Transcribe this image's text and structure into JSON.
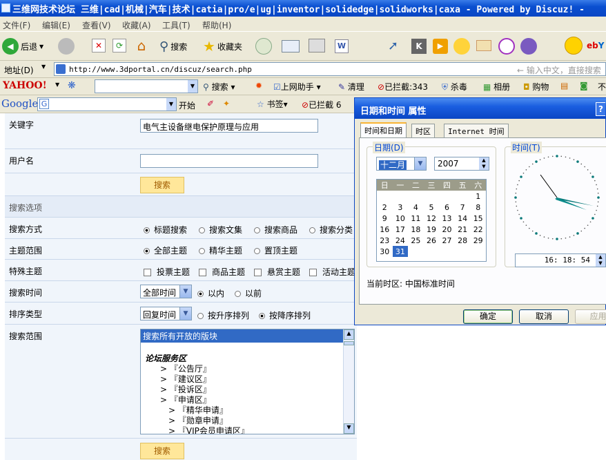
{
  "window": {
    "title": "三维网技术论坛 三维|cad|机械|汽车|技术|catia|pro/e|ug|inventor|solidedge|solidworks|caxa - Powered by Discuz! -"
  },
  "menu": [
    "文件(F)",
    "编辑(E)",
    "查看(V)",
    "收藏(A)",
    "工具(T)",
    "帮助(H)"
  ],
  "toolbar": {
    "back": "后退",
    "search": "搜索",
    "favorites": "收藏夹"
  },
  "address": {
    "label": "地址(D)",
    "url": "http://www.3dportal.cn/discuz/search.php",
    "hint": "输入中文，直接搜索"
  },
  "yahoo": {
    "logo": "YAHOO!",
    "search": "搜索",
    "helper": "上网助手",
    "clean": "清理",
    "blocked": "已拦截:343",
    "kill": "杀毒",
    "album": "相册",
    "shop": "购物",
    "more": "不"
  },
  "google": {
    "logo": "Google",
    "go": "开始",
    "bookmarks": "书签",
    "blocked": "已拦截 6"
  },
  "form": {
    "keyword_label": "关键字",
    "keyword_value": "电气主设备继电保护原理与应用",
    "username_label": "用户名",
    "username_value": "",
    "search_btn": "搜索",
    "options_header": "搜索选项",
    "method_label": "搜索方式",
    "method_options": [
      "标题搜索",
      "搜索文集",
      "搜索商品",
      "搜索分类"
    ],
    "scope_label": "主题范围",
    "scope_options": [
      "全部主题",
      "精华主题",
      "置顶主题"
    ],
    "special_label": "特殊主题",
    "special_options": [
      "投票主题",
      "商品主题",
      "悬赏主题",
      "活动主题"
    ],
    "time_label": "搜索时间",
    "time_value": "全部时间",
    "time_options": [
      "以内",
      "以前"
    ],
    "sort_label": "排序类型",
    "sort_value": "回复时间",
    "sort_options": [
      "按升序排列",
      "按降序排列"
    ],
    "forums_label": "搜索范围",
    "forums_selected": "搜索所有开放的版块",
    "forums_group": "论坛服务区",
    "forums_items": [
      "> 『公告厅』",
      "> 『建议区』",
      "> 『投诉区』",
      "> 『申请区』",
      "> 『精华申请』",
      "> 『勋章申请』",
      "> 『VIP会员申请区』"
    ],
    "search_btn2": "搜索"
  },
  "dialog": {
    "title": "日期和时间 属性",
    "help": "?",
    "tabs": [
      "时间和日期",
      "时区",
      "Internet 时间"
    ],
    "date_label": "日期(D)",
    "month": "十二月",
    "year": "2007",
    "weekdays": [
      "日",
      "一",
      "二",
      "三",
      "四",
      "五",
      "六"
    ],
    "days": [
      [
        "",
        "",
        "",
        "",
        "",
        "",
        "1"
      ],
      [
        "2",
        "3",
        "4",
        "5",
        "6",
        "7",
        "8"
      ],
      [
        "9",
        "10",
        "11",
        "12",
        "13",
        "14",
        "15"
      ],
      [
        "16",
        "17",
        "18",
        "19",
        "20",
        "21",
        "22"
      ],
      [
        "23",
        "24",
        "25",
        "26",
        "27",
        "28",
        "29"
      ],
      [
        "30",
        "31",
        "",
        "",
        "",
        "",
        ""
      ]
    ],
    "selected_day": "31",
    "time_label": "时间(T)",
    "time_value": "16: 18: 54",
    "timezone_text": "当前时区: 中国标准时间",
    "ok": "确定",
    "cancel": "取消",
    "apply": "应用(",
    "colors": {
      "title": "#0a46c4",
      "selected": "#316ac5"
    }
  }
}
